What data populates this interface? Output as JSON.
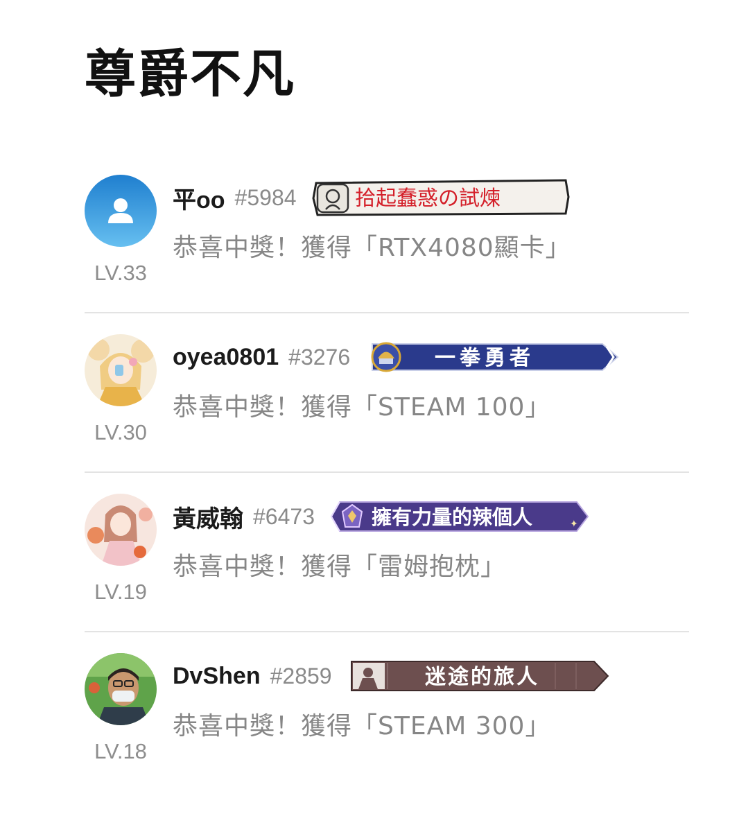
{
  "page": {
    "title": "尊爵不凡"
  },
  "winners": [
    {
      "username": "平oo",
      "user_id": "#5984",
      "level": "LV.33",
      "badge": {
        "title": "拾起蠢惑の試煉",
        "icon": "knight-portrait-icon",
        "style": "paper-scroll"
      },
      "avatar": "default-user-icon",
      "prize_prefix": "恭喜中獎！獲得",
      "prize": "「RTX4080顯卡」"
    },
    {
      "username": "oyea0801",
      "user_id": "#3276",
      "level": "LV.30",
      "badge": {
        "title": "一拳勇者",
        "icon": "helmet-icon",
        "style": "navy-banner"
      },
      "avatar": "anime-girl-avatar",
      "prize_prefix": "恭喜中獎！獲得",
      "prize": "「STEAM 100」"
    },
    {
      "username": "黃威翰",
      "user_id": "#6473",
      "level": "LV.19",
      "badge": {
        "title": "擁有力量的辣個人",
        "icon": "crystal-icon",
        "style": "purple-banner"
      },
      "avatar": "anime-girl-avatar",
      "prize_prefix": "恭喜中獎！獲得",
      "prize": "「雷姆抱枕」"
    },
    {
      "username": "DvShen",
      "user_id": "#2859",
      "level": "LV.18",
      "badge": {
        "title": "迷途的旅人",
        "icon": "traveler-icon",
        "style": "brown-banner"
      },
      "avatar": "photo-avatar",
      "prize_prefix": "恭喜中獎！獲得",
      "prize": "「STEAM 300」"
    }
  ],
  "colors": {
    "title": "#111111",
    "username": "#1b1b1b",
    "muted_text": "#868686",
    "divider": "#e3e3e3",
    "avatar_blue": "#2f8fd6",
    "badge_navy": "#2a3a8c",
    "badge_purple": "#4a3a8a",
    "badge_brown": "#6d4f4f",
    "badge_red_text": "#d4202a"
  }
}
